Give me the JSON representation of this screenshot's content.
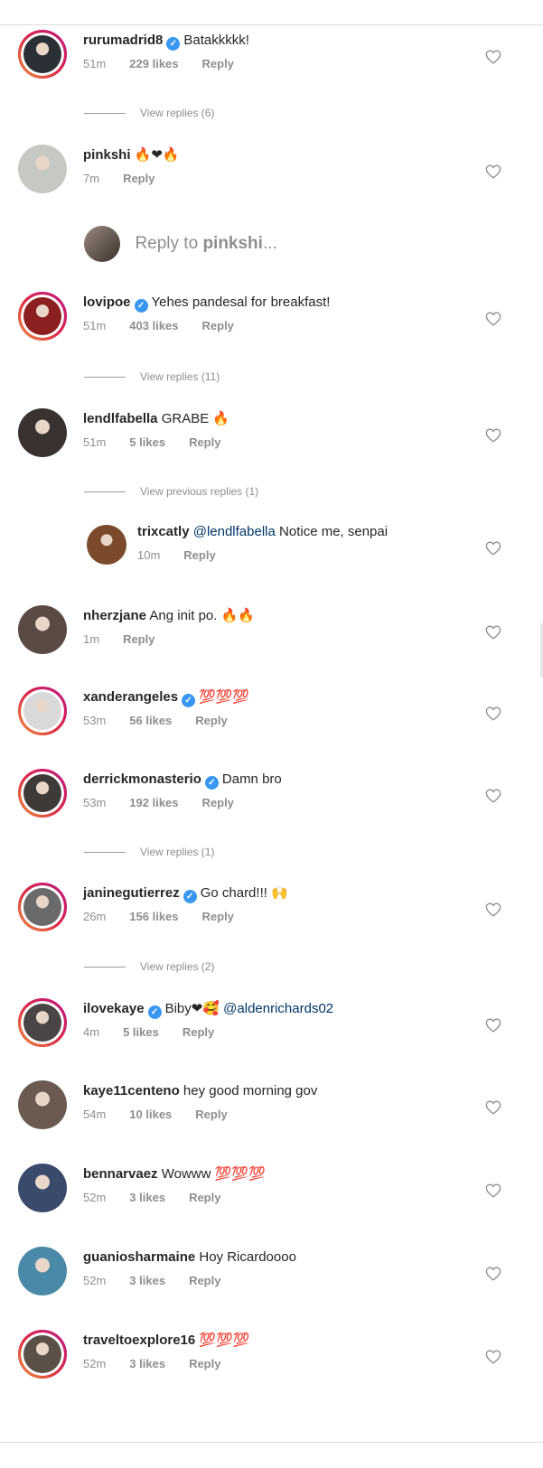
{
  "colors": {
    "verified": "#3897f0",
    "meta_gray": "#8e8e8e",
    "text": "#262626",
    "ring": "#dc2743"
  },
  "comments": [
    {
      "username": "rurumadrid8",
      "verified": true,
      "text": "Batakkkkk!",
      "time": "51m",
      "likes": "229 likes",
      "reply": "Reply",
      "story_ring": true,
      "avatar_color": "#2b2f36"
    },
    {
      "username": "pinkshi",
      "verified": false,
      "text": "🔥❤🔥",
      "time": "7m",
      "likes": "",
      "reply": "Reply",
      "story_ring": false,
      "avatar_color": "#c6c8c4"
    },
    {
      "username": "lovipoe",
      "verified": true,
      "text": "Yehes pandesal for breakfast!",
      "time": "51m",
      "likes": "403 likes",
      "reply": "Reply",
      "story_ring": true,
      "avatar_color": "#8c1f1f"
    },
    {
      "username": "lendlfabella",
      "verified": false,
      "text": "GRABE 🔥",
      "time": "51m",
      "likes": "5 likes",
      "reply": "Reply",
      "story_ring": false,
      "avatar_color": "#3a3230"
    },
    {
      "username": "trixcatly",
      "verified": false,
      "mention": "@lendlfabella",
      "text": "Notice me, senpai",
      "time": "10m",
      "likes": "",
      "reply": "Reply",
      "story_ring": false,
      "avatar_color": "#7a4a2a"
    },
    {
      "username": "nherzjane",
      "verified": false,
      "text": "Ang init po. 🔥🔥",
      "time": "1m",
      "likes": "",
      "reply": "Reply",
      "story_ring": false,
      "avatar_color": "#5a4a44"
    },
    {
      "username": "xanderangeles",
      "verified": true,
      "text": "💯💯💯",
      "time": "53m",
      "likes": "56 likes",
      "reply": "Reply",
      "story_ring": true,
      "avatar_color": "#d9d9d9"
    },
    {
      "username": "derrickmonasterio",
      "verified": true,
      "text": "Damn bro",
      "time": "53m",
      "likes": "192 likes",
      "reply": "Reply",
      "story_ring": true,
      "avatar_color": "#3d3a38"
    },
    {
      "username": "janinegutierrez",
      "verified": true,
      "text": "Go chard!!! 🙌",
      "time": "26m",
      "likes": "156 likes",
      "reply": "Reply",
      "story_ring": true,
      "avatar_color": "#6a6a6a"
    },
    {
      "username": "ilovekaye",
      "verified": true,
      "text": "Biby❤🥰",
      "mention": "@aldenrichards02",
      "time": "4m",
      "likes": "5 likes",
      "reply": "Reply",
      "story_ring": true,
      "avatar_color": "#4a4444"
    },
    {
      "username": "kaye11centeno",
      "verified": false,
      "text": "hey good morning gov",
      "time": "54m",
      "likes": "10 likes",
      "reply": "Reply",
      "story_ring": false,
      "avatar_color": "#6b5a50"
    },
    {
      "username": "bennarvaez",
      "verified": false,
      "text": "Wowww 💯💯💯",
      "time": "52m",
      "likes": "3 likes",
      "reply": "Reply",
      "story_ring": false,
      "avatar_color": "#3a4a6a"
    },
    {
      "username": "guaniosharmaine",
      "verified": false,
      "text": "Hoy Ricardoooo",
      "time": "52m",
      "likes": "3 likes",
      "reply": "Reply",
      "story_ring": false,
      "avatar_color": "#4a8aa8"
    },
    {
      "username": "traveltoexplore16",
      "verified": false,
      "text": "💯💯💯",
      "time": "52m",
      "likes": "3 likes",
      "reply": "Reply",
      "story_ring": true,
      "avatar_color": "#5a5048"
    }
  ],
  "view_replies": [
    "View replies (6)",
    "View replies (11)",
    "View previous replies (1)",
    "View replies (1)",
    "View replies (2)"
  ],
  "reply_box": {
    "prefix": "Reply to ",
    "username": "pinkshi",
    "suffix": "..."
  }
}
